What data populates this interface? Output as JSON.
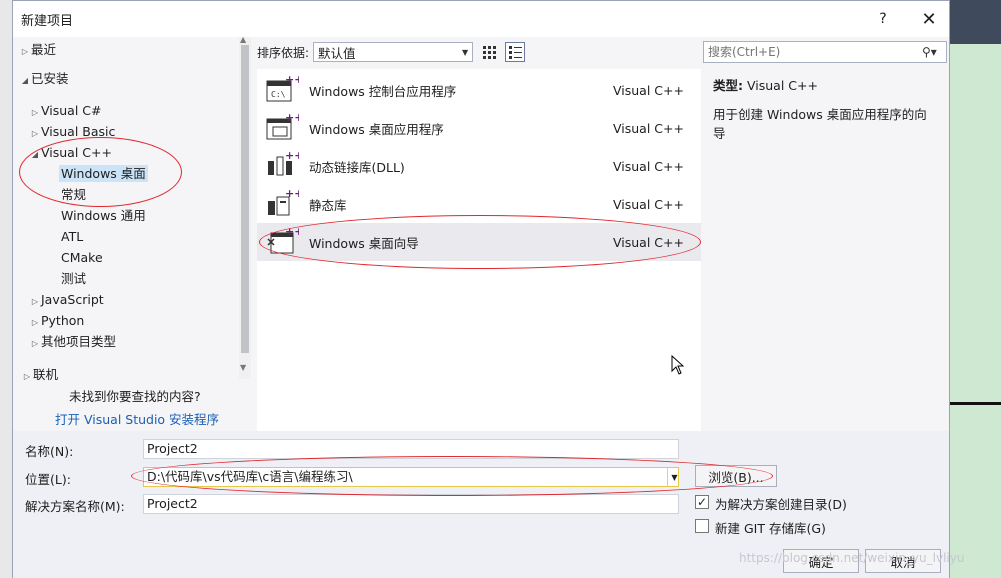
{
  "dialog": {
    "title": "新建项目",
    "help": "?",
    "close": "✕"
  },
  "tree": {
    "recent": "最近",
    "installed": "已安装",
    "visual_cs": "Visual C#",
    "visual_basic": "Visual Basic",
    "visual_cpp": "Visual C++",
    "windows_desktop": "Windows 桌面",
    "general": "常规",
    "windows_universal": "Windows 通用",
    "atl": "ATL",
    "cmake": "CMake",
    "test": "测试",
    "javascript": "JavaScript",
    "python": "Python",
    "other_types": "其他项目类型",
    "online": "联机",
    "not_found": "未找到你要查找的内容?",
    "open_installer": "打开 Visual Studio 安装程序"
  },
  "sort": {
    "label": "排序依据:",
    "value": "默认值"
  },
  "search": {
    "placeholder": "搜索(Ctrl+E)"
  },
  "templates": [
    {
      "name": "Windows 控制台应用程序",
      "lang": "Visual C++",
      "icon": "console-app-icon"
    },
    {
      "name": "Windows 桌面应用程序",
      "lang": "Visual C++",
      "icon": "desktop-app-icon"
    },
    {
      "name": "动态链接库(DLL)",
      "lang": "Visual C++",
      "icon": "dll-icon"
    },
    {
      "name": "静态库",
      "lang": "Visual C++",
      "icon": "static-lib-icon"
    },
    {
      "name": "Windows 桌面向导",
      "lang": "Visual C++",
      "icon": "desktop-wizard-icon"
    }
  ],
  "details": {
    "type_label": "类型:",
    "type_value": "Visual C++",
    "description": "用于创建 Windows 桌面应用程序的向导"
  },
  "form": {
    "name_label": "名称(N):",
    "name_value": "Project2",
    "location_label": "位置(L):",
    "location_value": "D:\\代码库\\vs代码库\\c语言\\编程练习\\",
    "browse_label": "浏览(B)...",
    "solution_label": "解决方案名称(M):",
    "solution_value": "Project2",
    "create_dir_label": "为解决方案创建目录(D)",
    "create_dir_checked": true,
    "git_label": "新建 GIT 存储库(G)",
    "git_checked": false,
    "ok_label": "确定",
    "cancel_label": "取消"
  },
  "watermark": "https://blog.csdn.net/weixin_yu_lvliyu"
}
